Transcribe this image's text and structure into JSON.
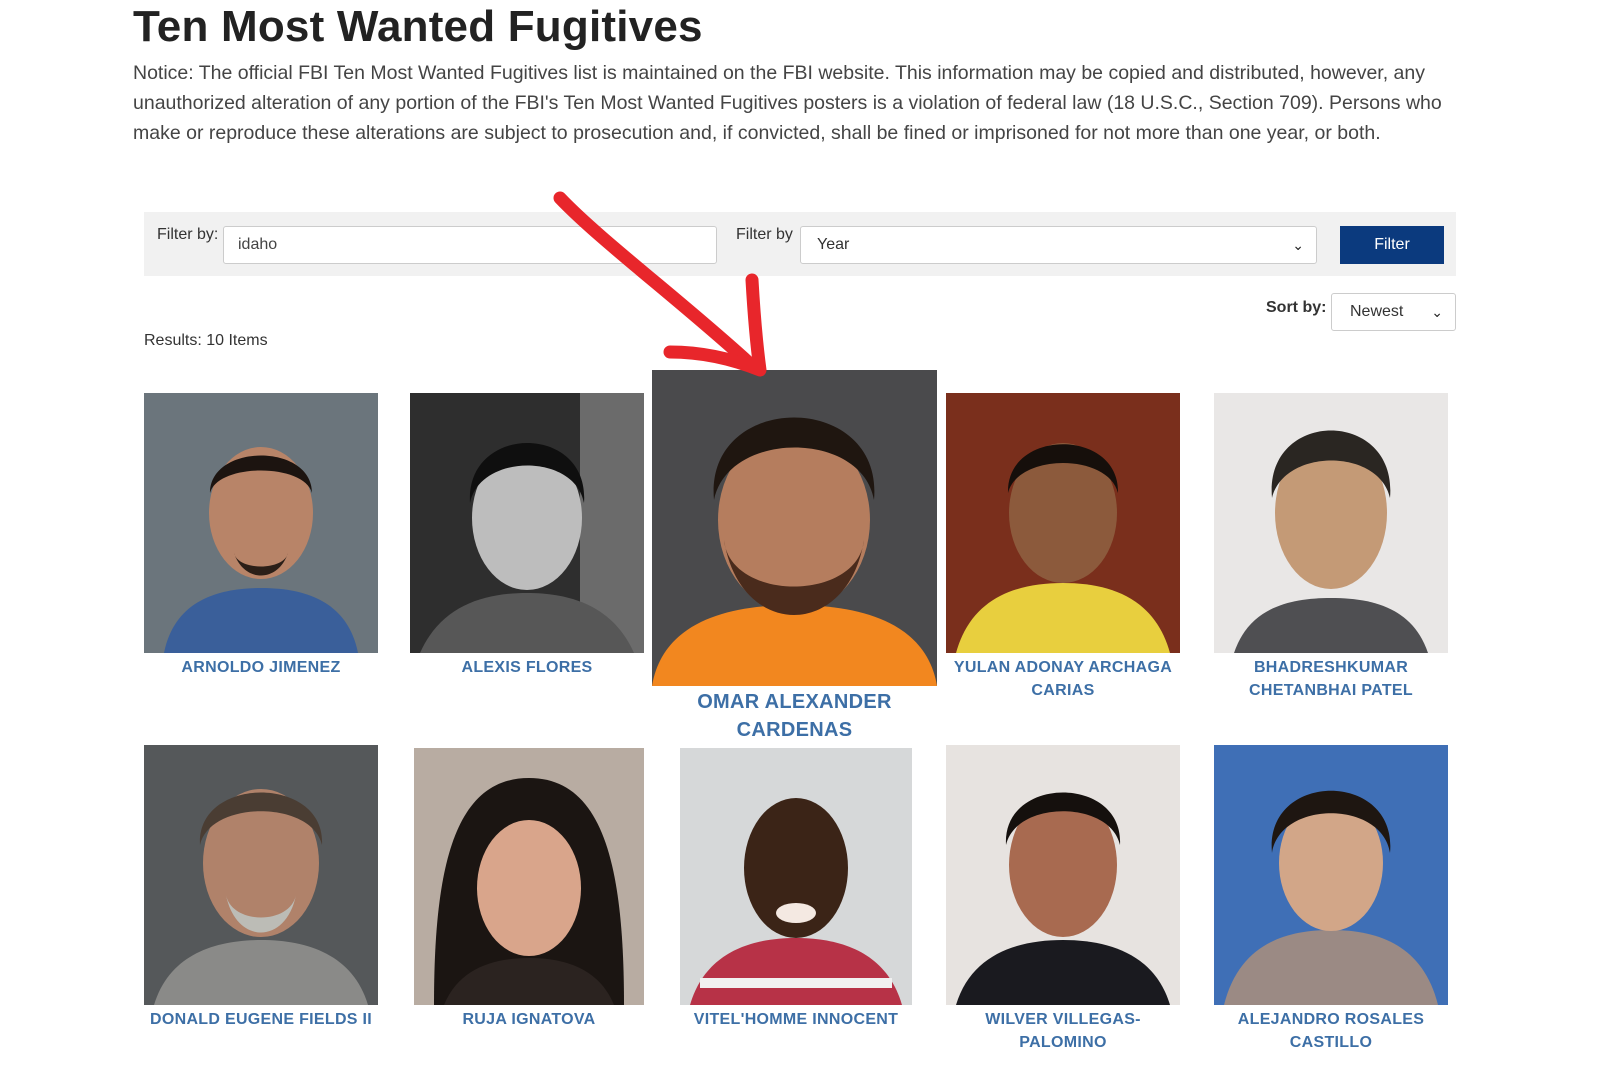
{
  "page": {
    "title": "Ten Most Wanted Fugitives",
    "notice": "Notice: The official FBI Ten Most Wanted Fugitives list is maintained on the FBI website. This information may be copied and distributed, however, any unauthorized alteration of any portion of the FBI's Ten Most Wanted Fugitives posters is a violation of federal law (18 U.S.C., Section 709). Persons who make or reproduce these alterations are subject to prosecution and, if convicted, shall be fined or imprisoned for not more than one year, or both."
  },
  "filters": {
    "text_label": "Filter by:",
    "text_value": "idaho",
    "select_label": "Filter by",
    "select_value": "Year",
    "button_label": "Filter"
  },
  "sort": {
    "label": "Sort by:",
    "value": "Newest"
  },
  "results": {
    "text": "Results: 10 Items"
  },
  "fugitives": [
    {
      "name": "ARNOLDO JIMENEZ"
    },
    {
      "name": "ALEXIS FLORES"
    },
    {
      "name": "OMAR ALEXANDER CARDENAS"
    },
    {
      "name": "YULAN ADONAY ARCHAGA CARIAS"
    },
    {
      "name": "BHADRESHKUMAR CHETANBHAI PATEL"
    },
    {
      "name": "DONALD EUGENE FIELDS II"
    },
    {
      "name": "RUJA IGNATOVA"
    },
    {
      "name": "VITEL'HOMME INNOCENT"
    },
    {
      "name": "WILVER VILLEGAS-PALOMINO"
    },
    {
      "name": "ALEJANDRO ROSALES CASTILLO"
    }
  ],
  "colors": {
    "accent": "#0b3a7e",
    "name_link": "#3d6fa6",
    "annotation_arrow": "#e8262b"
  }
}
